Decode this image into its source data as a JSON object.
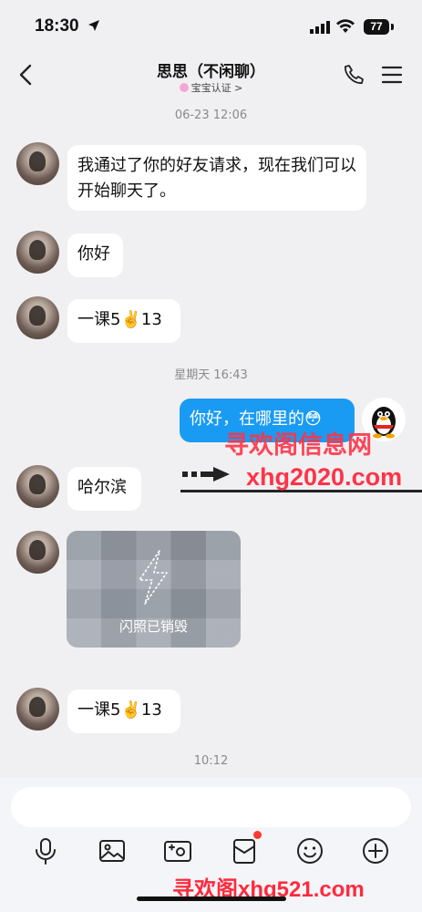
{
  "status_bar": {
    "time": "18:30",
    "battery": "77"
  },
  "header": {
    "title": "思思（不闲聊）",
    "subtitle": "宝宝认证 >"
  },
  "messages": [
    {
      "type": "timestamp",
      "text": "06-23 12:06"
    },
    {
      "type": "incoming",
      "text": "我通过了你的好友请求，现在我们可以开始聊天了。"
    },
    {
      "type": "incoming",
      "text": "你好"
    },
    {
      "type": "incoming",
      "text": "一课5✌️13"
    },
    {
      "type": "timestamp",
      "text": "星期天 16:43"
    },
    {
      "type": "outgoing",
      "text": "你好，在哪里的😳"
    },
    {
      "type": "incoming",
      "text": "哈尔滨"
    },
    {
      "type": "incoming_snap",
      "text": "闪照已销毁"
    },
    {
      "type": "incoming",
      "text": "一课5✌️13"
    },
    {
      "type": "timestamp",
      "text": "10:12"
    }
  ],
  "watermarks": {
    "top": "寻欢阁信息网",
    "site": "xhg2020.com",
    "bottom": "寻欢阁xhg521.com"
  },
  "toolbar": [
    "microphone-icon",
    "image-icon",
    "camera-icon",
    "redpacket-icon",
    "emoji-icon",
    "plus-icon"
  ],
  "colors": {
    "outgoing_bubble": "#1a9bf3",
    "background": "#f0f0f2",
    "watermark": "#ff3347"
  }
}
